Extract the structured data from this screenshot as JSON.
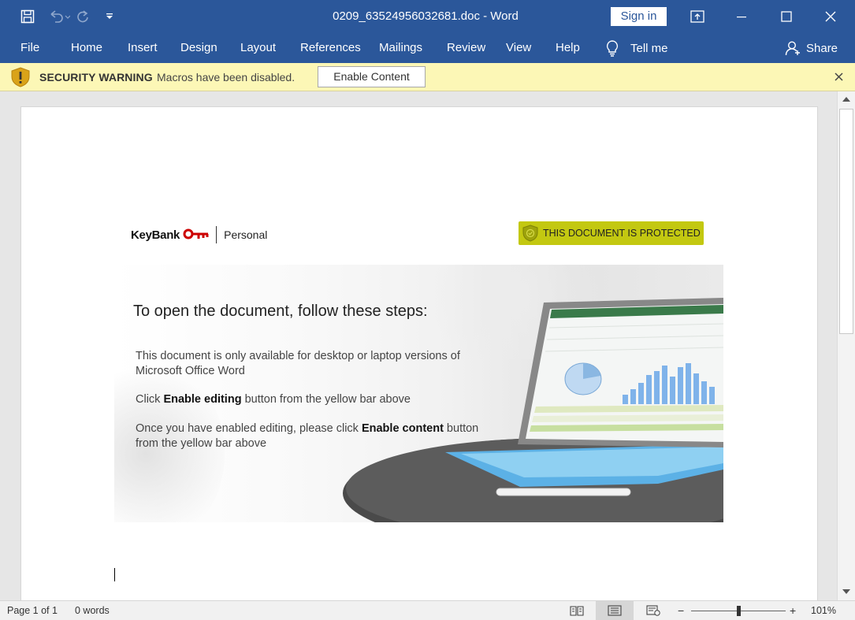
{
  "titlebar": {
    "document_title": "0209_63524956032681.doc  -  Word",
    "sign_in": "Sign in"
  },
  "ribbon": {
    "tabs": [
      "File",
      "Home",
      "Insert",
      "Design",
      "Layout",
      "References",
      "Mailings",
      "Review",
      "View",
      "Help"
    ],
    "tell_me": "Tell me",
    "share": "Share"
  },
  "security_bar": {
    "title": "SECURITY WARNING",
    "message": "Macros have been disabled.",
    "button": "Enable Content",
    "color": "#fcf7b6"
  },
  "document": {
    "logo_name": "KeyBank",
    "logo_sub": "Personal",
    "badge": "THIS DOCUMENT IS PROTECTED",
    "badge_color": "#c3c811",
    "heading": "To open the document, follow these steps:",
    "step1": "This document is only available for desktop or laptop versions of Microsoft Office Word",
    "step2_pre": "Click ",
    "step2_bold": "Enable editing",
    "step2_post": " button from the yellow bar above",
    "step3_pre": "Once you have enabled editing, please click ",
    "step3_bold": "Enable content",
    "step3_post": " button from the yellow bar above"
  },
  "status": {
    "page": "Page 1 of 1",
    "words": "0 words",
    "zoom_minus": "−",
    "zoom_plus": "+",
    "zoom": "101%"
  },
  "colors": {
    "brand": "#2b579a",
    "keybank_red": "#cc0000"
  }
}
